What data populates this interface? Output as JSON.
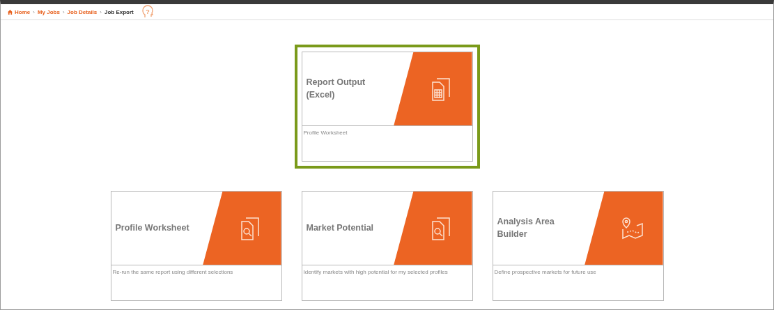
{
  "breadcrumb": [
    {
      "label": "Home",
      "kind": "home",
      "current": false
    },
    {
      "label": "My Jobs",
      "kind": "link",
      "current": false
    },
    {
      "label": "Job Details",
      "kind": "link",
      "current": false
    },
    {
      "label": "Job Export",
      "kind": "link",
      "current": true
    }
  ],
  "separator": "›",
  "help_icon": "?",
  "rows": [
    {
      "cards": [
        {
          "title": "Report Output (Excel)",
          "description": "Profile Worksheet",
          "kind": "spreadsheet",
          "selected": true
        }
      ]
    },
    {
      "cards": [
        {
          "title": "Profile Worksheet",
          "description": "Re-run the same report using different selections",
          "kind": "search-doc",
          "selected": false
        },
        {
          "title": "Market Potential",
          "description": "Identify markets with high potential for my selected profiles",
          "kind": "search-doc",
          "selected": false
        },
        {
          "title": "Analysis Area Builder",
          "description": "Define prospective markets for future use",
          "kind": "map",
          "selected": false
        }
      ]
    }
  ]
}
